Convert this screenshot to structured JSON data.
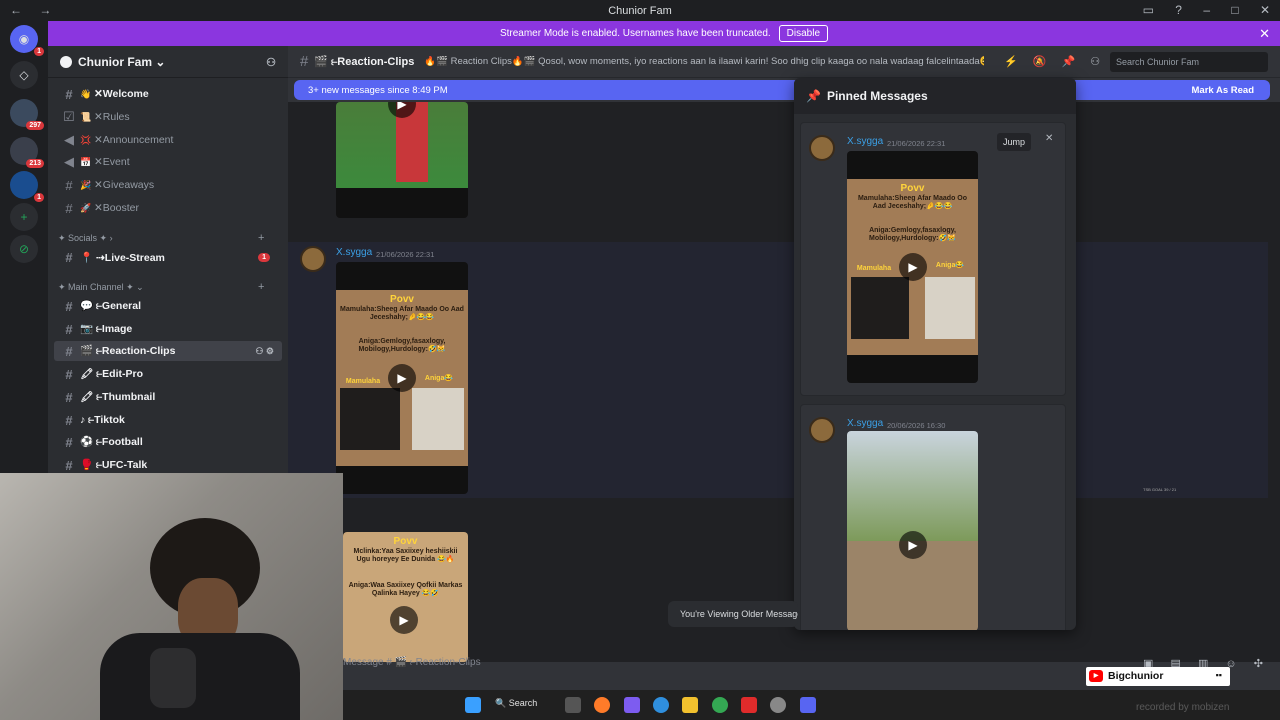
{
  "window": {
    "title": "Chunior Fam",
    "back": "←",
    "forward": "→"
  },
  "banner": {
    "text": "Streamer Mode is enabled. Usernames have been truncated.",
    "button": "Disable",
    "close": "✕"
  },
  "servers": [
    {
      "badge": "1"
    },
    {
      "badge": ""
    },
    {
      "badge": "297"
    },
    {
      "badge": "213"
    },
    {
      "badge": "1"
    }
  ],
  "guild": {
    "name": "Chunior Fam ⌄"
  },
  "channels": [
    {
      "emoji": "👋",
      "label": "✕Welcome",
      "bright": true
    },
    {
      "emoji": "📜",
      "label": "✕Rules",
      "bright": false
    },
    {
      "emoji": "💢",
      "label": "✕Announcement",
      "bright": false
    },
    {
      "emoji": "📅",
      "label": "✕Event",
      "bright": false
    },
    {
      "emoji": "🎉",
      "label": "✕Giveaways",
      "bright": false
    },
    {
      "emoji": "🚀",
      "label": "✕Booster",
      "bright": false
    }
  ],
  "categories": {
    "socials": "✦ Socials ✦  ›",
    "main": "✦ Main Channel ✦  ⌄"
  },
  "live_stream": {
    "label": "📍 ⇢Live-Stream",
    "badge": "1"
  },
  "main_channels": [
    {
      "label": "💬 ⥼General"
    },
    {
      "label": "📷 ⥼Image"
    },
    {
      "label": "🎬 ⥼Reaction-Clips"
    },
    {
      "label": "🖍 ⥼Edit-Pro"
    },
    {
      "label": "🖍 ⥼Thumbnail"
    },
    {
      "label": "♪ ⥼Tiktok"
    },
    {
      "label": "⚽ ⥼Football"
    },
    {
      "label": "🥊 ⥼UFC-Talk"
    }
  ],
  "topbar": {
    "channel": "🎬 ⥼Reaction-Clips",
    "topic": "🔥🎬 Reaction Clips🔥🎬 Qosol, wow moments, iyo reactions aan la ilaawi karin! Soo dhig clip kaaga oo nala wadaag falcelintaada😆",
    "search_placeholder": "Search Chunior Fam"
  },
  "new_messages": {
    "text": "3+ new messages since 8:49 PM",
    "mark": "Mark As Read"
  },
  "message": {
    "author": "X.sygga",
    "timestamp": "21/06/2026 22:31"
  },
  "pov": {
    "title": "Povv",
    "line1": "Mamulaha:Sheeg Afar Maado Oo Aad Jeceshahy;🤌😂😂",
    "line2": "Aniga:Gemlogy,fasaxlogy, Mobilogy,Hurdology:🤣😹",
    "caption_left": "Mamulaha",
    "caption_right": "Aniga😂"
  },
  "pov2": {
    "title": "Povv",
    "line1": "Mclinka:Yaa Saxiixey heshiiskii Ugu horeyey Ee Dunida 😂🔥",
    "line2": "Aniga:Waa Saxiixey Qofkii Markas Qalinka Hayey 😂🤣"
  },
  "pinned": {
    "title": "Pinned Messages",
    "jump": "Jump",
    "close": "✕",
    "items": [
      {
        "author": "X.sygga",
        "timestamp": "21/06/2026 22:31"
      },
      {
        "author": "X.sygga",
        "timestamp": "20/06/2026 16:30"
      }
    ]
  },
  "older_notice": "You're Viewing Older Messages",
  "composer": {
    "placeholder": "Message # 🎬 ⥼Reaction-Clips"
  },
  "taskbar": {
    "search": "Search"
  },
  "stream_overlay": {
    "channel": "Bigchunior",
    "bars": "▪▪"
  },
  "watermark": "recorded by mobizen",
  "scoreboard": "TSB GOAL 39 / 21",
  "colors": {
    "accent": "#5865f2",
    "banner": "#8b36df",
    "link": "#3ba0e6",
    "danger": "#da373c"
  }
}
